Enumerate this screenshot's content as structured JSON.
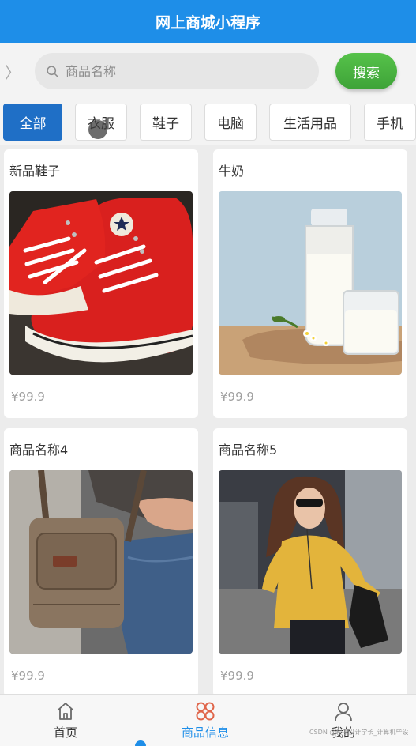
{
  "header": {
    "title": "网上商城小程序"
  },
  "search": {
    "placeholder": "商品名称",
    "button_label": "搜索"
  },
  "categories": [
    "全部",
    "衣服",
    "鞋子",
    "电脑",
    "生活用品",
    "手机"
  ],
  "products": [
    {
      "name": "新品鞋子",
      "price": "¥99.9",
      "image": "red-sneakers"
    },
    {
      "name": "牛奶",
      "price": "¥99.9",
      "image": "milk-bottle"
    },
    {
      "name": "商品名称4",
      "price": "¥99.9",
      "image": "canvas-bag"
    },
    {
      "name": "商品名称5",
      "price": "¥99.9",
      "image": "yellow-sweater-woman"
    }
  ],
  "tabs": [
    {
      "label": "首页",
      "icon": "home-icon",
      "active": false
    },
    {
      "label": "商品信息",
      "icon": "grid-icon",
      "active": true
    },
    {
      "label": "我的",
      "icon": "user-icon",
      "active": false
    }
  ],
  "watermark": "CSDN @程序设计学长_计算机毕设",
  "colors": {
    "header": "#1e8ee8",
    "search_button": "#4fb545",
    "active_category": "#1f6fc6",
    "active_tab": "#e0654a",
    "active_tab_text": "#1e8ee8"
  }
}
